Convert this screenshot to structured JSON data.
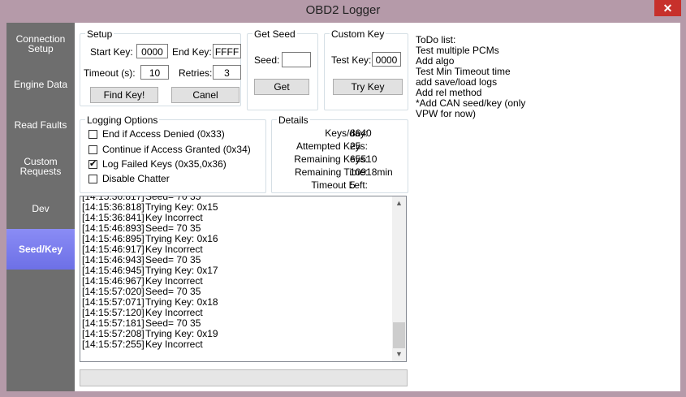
{
  "window": {
    "title": "OBD2 Logger",
    "close_glyph": "✕"
  },
  "nav": {
    "items": [
      {
        "label": "Connection\nSetup"
      },
      {
        "label": "Engine Data"
      },
      {
        "label": "Read Faults"
      },
      {
        "label": "Custom\nRequests"
      },
      {
        "label": "Dev"
      },
      {
        "label": "Seed/Key"
      }
    ],
    "selected": "Seed/Key"
  },
  "setup": {
    "legend": "Setup",
    "start_key_label": "Start Key:",
    "start_key_value": "0000",
    "end_key_label": "End Key:",
    "end_key_value": "FFFF",
    "timeout_label": "Timeout (s):",
    "timeout_value": "10",
    "retries_label": "Retries:",
    "retries_value": "3",
    "find_key_button": "Find Key!",
    "cancel_button": "Canel"
  },
  "get_seed": {
    "legend": "Get Seed",
    "seed_label": "Seed:",
    "seed_value": "",
    "get_button": "Get"
  },
  "custom_key": {
    "legend": "Custom Key",
    "test_key_label": "Test Key:",
    "test_key_value": "0000",
    "try_key_button": "Try Key"
  },
  "logging_options": {
    "legend": "Logging Options",
    "options": [
      {
        "label": "End if Access Denied (0x33)",
        "checked": false
      },
      {
        "label": "Continue if Access Granted (0x34)",
        "checked": false
      },
      {
        "label": "Log Failed Keys (0x35,0x36)",
        "checked": true
      },
      {
        "label": "Disable Chatter",
        "checked": false
      }
    ]
  },
  "details": {
    "legend": "Details",
    "rows": [
      {
        "label": "Keys/day:",
        "value": "8640"
      },
      {
        "label": "Attempted Keys:",
        "value": "25"
      },
      {
        "label": "Remaining Keys:",
        "value": "65510"
      },
      {
        "label": "Remaining Time:",
        "value": "10918min"
      },
      {
        "label": "Timeout Left:",
        "value": "5"
      }
    ]
  },
  "log": {
    "lines": [
      {
        "time": "[14:15:36:817]",
        "msg": "Seed= 70 35"
      },
      {
        "time": "[14:15:36:818]",
        "msg": "Trying Key: 0x15"
      },
      {
        "time": "[14:15:36:841]",
        "msg": "Key Incorrect"
      },
      {
        "time": "[14:15:46:893]",
        "msg": "Seed= 70 35"
      },
      {
        "time": "[14:15:46:895]",
        "msg": "Trying Key: 0x16"
      },
      {
        "time": "[14:15:46:917]",
        "msg": "Key Incorrect"
      },
      {
        "time": "[14:15:46:943]",
        "msg": "Seed= 70 35"
      },
      {
        "time": "[14:15:46:945]",
        "msg": "Trying Key: 0x17"
      },
      {
        "time": "[14:15:46:967]",
        "msg": "Key Incorrect"
      },
      {
        "time": "[14:15:57:020]",
        "msg": "Seed= 70 35"
      },
      {
        "time": "[14:15:57:071]",
        "msg": "Trying Key: 0x18"
      },
      {
        "time": "[14:15:57:120]",
        "msg": "Key Incorrect"
      },
      {
        "time": "[14:15:57:181]",
        "msg": "Seed= 70 35"
      },
      {
        "time": "[14:15:57:208]",
        "msg": "Trying Key: 0x19"
      },
      {
        "time": "[14:15:57:255]",
        "msg": "Key Incorrect"
      }
    ],
    "scroll_up_glyph": "▲",
    "scroll_down_glyph": "▼"
  },
  "progress": {
    "value": 0
  },
  "todo": {
    "lines": [
      "ToDo list:",
      "Test multiple PCMs",
      "Add algo",
      "Test Min Timeout time",
      "add save/load logs",
      "Add rel method",
      "*Add CAN seed/key (only",
      "VPW for now)"
    ]
  }
}
